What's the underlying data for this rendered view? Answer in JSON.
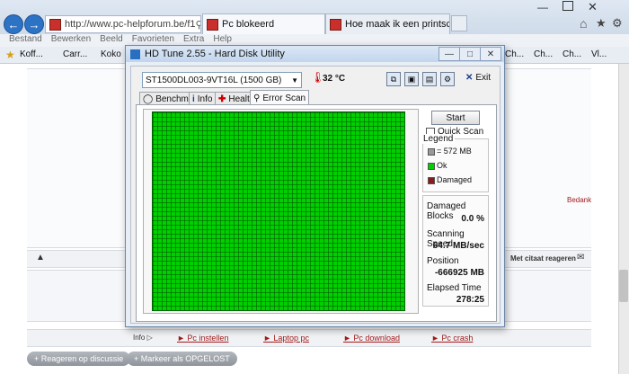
{
  "browser": {
    "url": "http://www.pc-helpforum.be/f1",
    "tabs": [
      {
        "label": "Pc blokeerd"
      },
      {
        "label": "Hoe maak ik een printscreen m..."
      }
    ],
    "menu": [
      "Bestand",
      "Bewerken",
      "Beeld",
      "Favorieten",
      "Extra",
      "Help"
    ],
    "favorites": [
      "Koff...",
      "Carr...",
      "Koko"
    ],
    "favorites_right": [
      "Ch...",
      "Ch...",
      "Ch...",
      "Vl..."
    ]
  },
  "page": {
    "bedank_label": "Bedank",
    "quote_reply_label": "Met citaat reageren",
    "info_label": "Info",
    "footer_links": [
      "Pc instellen",
      "Laptop pc",
      "Pc download",
      "Pc crash"
    ],
    "reply_button": "+ Reageren op discussie",
    "solved_button": "+ Markeer als OPGELOST"
  },
  "hdtune": {
    "title": "HD Tune 2.55 - Hard Disk Utility",
    "drive": "ST1500DL003-9VT16L (1500 GB)",
    "temperature": "32 °C",
    "exit_label": "Exit",
    "tabs": [
      "Benchmark",
      "Info",
      "Health",
      "Error Scan"
    ],
    "start_label": "Start",
    "quick_scan_label": "Quick Scan",
    "legend_title": "Legend",
    "legend_block": "= 572 MB",
    "legend_ok": "Ok",
    "legend_damaged": "Damaged",
    "damaged_blocks_label": "Damaged Blocks",
    "damaged_blocks_value": "0.0 %",
    "scanning_speed_label": "Scanning Speed",
    "scanning_speed_value": "64.7 MB/sec",
    "position_label": "Position",
    "position_value": "-666925 MB",
    "elapsed_label": "Elapsed Time",
    "elapsed_value": "278:25"
  },
  "colors": {
    "ok": "#00d000",
    "damaged": "#8b1a1a",
    "accent": "#2c73c5"
  }
}
